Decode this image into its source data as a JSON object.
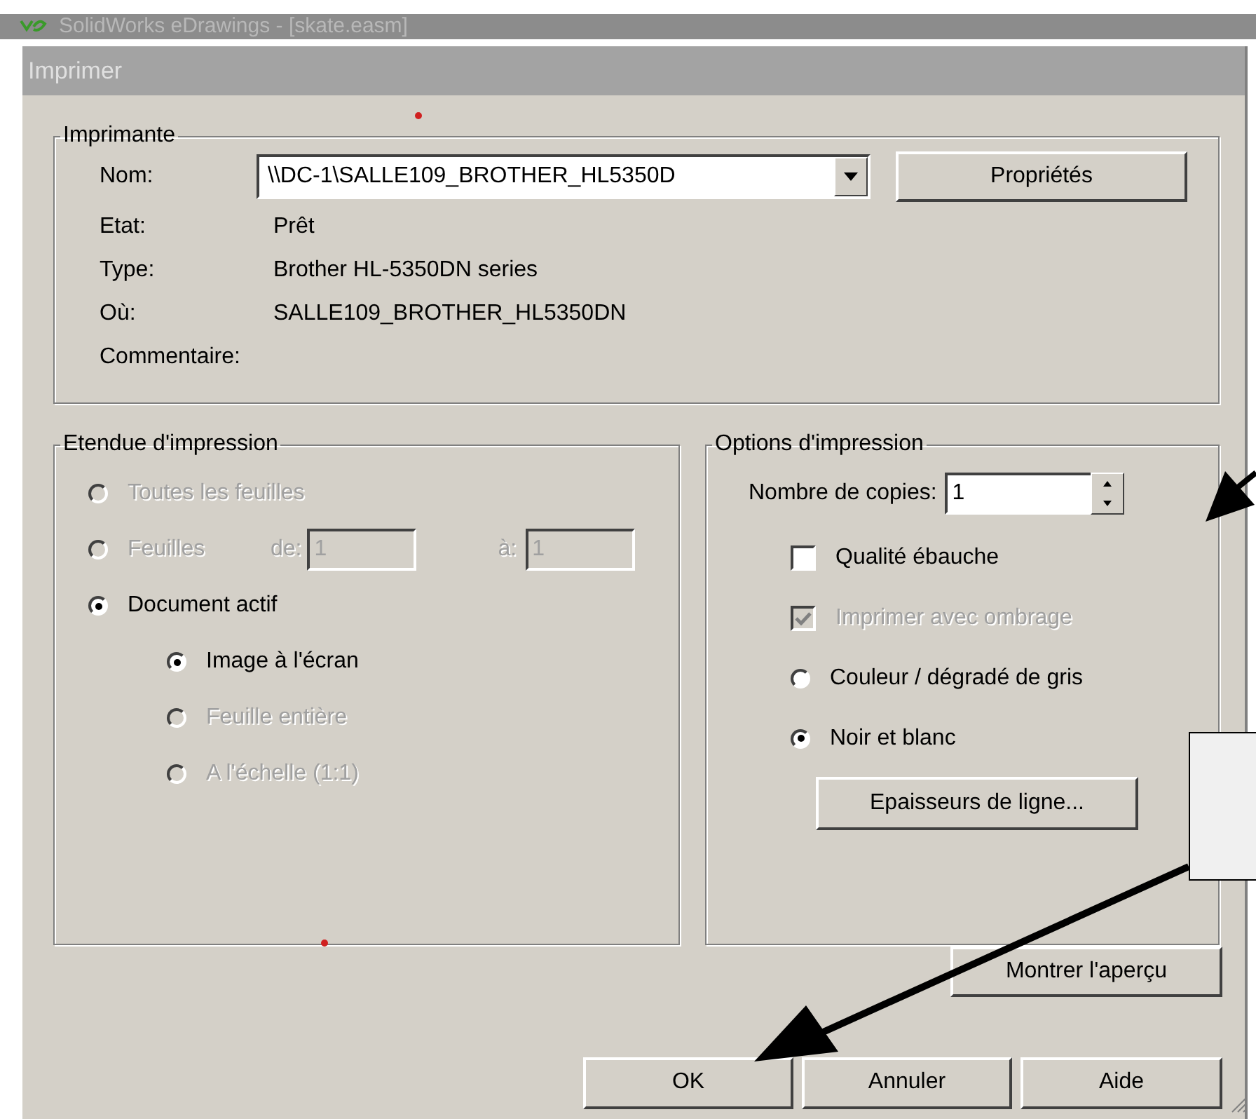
{
  "app_window": {
    "title": "SolidWorks eDrawings - [skate.easm]"
  },
  "dialog": {
    "title": "Imprimer"
  },
  "printer": {
    "legend": "Imprimante",
    "name_label": "Nom:",
    "name_value": "\\\\DC-1\\SALLE109_BROTHER_HL5350D",
    "properties_button": "Propriétés",
    "details": [
      {
        "label": "Etat:",
        "value": "Prêt"
      },
      {
        "label": "Type:",
        "value": "Brother HL-5350DN series"
      },
      {
        "label": "Où:",
        "value": "SALLE109_BROTHER_HL5350DN"
      },
      {
        "label": "Commentaire:"
      }
    ]
  },
  "print_range": {
    "legend": "Etendue d'impression",
    "options": [
      {
        "label": "Toutes les feuilles",
        "selected": false,
        "disabled": true
      },
      {
        "label": "Feuilles",
        "selected": false,
        "disabled": true,
        "from_label": "de:",
        "from_value": "1",
        "to_label": "à:",
        "to_value": "1"
      },
      {
        "label": "Document actif",
        "selected": true,
        "disabled": false,
        "children": [
          {
            "label": "Image à l'écran",
            "selected": true,
            "disabled": false
          },
          {
            "label": "Feuille entière",
            "selected": false,
            "disabled": true
          },
          {
            "label": "A l'échelle (1:1)",
            "selected": false,
            "disabled": true
          }
        ]
      }
    ]
  },
  "print_options": {
    "legend": "Options d'impression",
    "copies_label": "Nombre de copies:",
    "copies_value": "1",
    "items": [
      {
        "kind": "checkbox",
        "label": "Qualité ébauche",
        "checked": false,
        "disabled": false
      },
      {
        "kind": "checkbox",
        "label": "Imprimer avec ombrage",
        "checked": true,
        "disabled": true
      },
      {
        "kind": "radio",
        "label": "Couleur / dégradé de gris",
        "selected": false,
        "disabled": false
      },
      {
        "kind": "radio",
        "label": "Noir et blanc",
        "selected": true,
        "disabled": false
      }
    ],
    "line_weights_button": "Epaisseurs de ligne..."
  },
  "preview_button": "Montrer l'aperçu",
  "buttons": [
    {
      "label": "OK"
    },
    {
      "label": "Annuler"
    },
    {
      "label": "Aide"
    }
  ]
}
